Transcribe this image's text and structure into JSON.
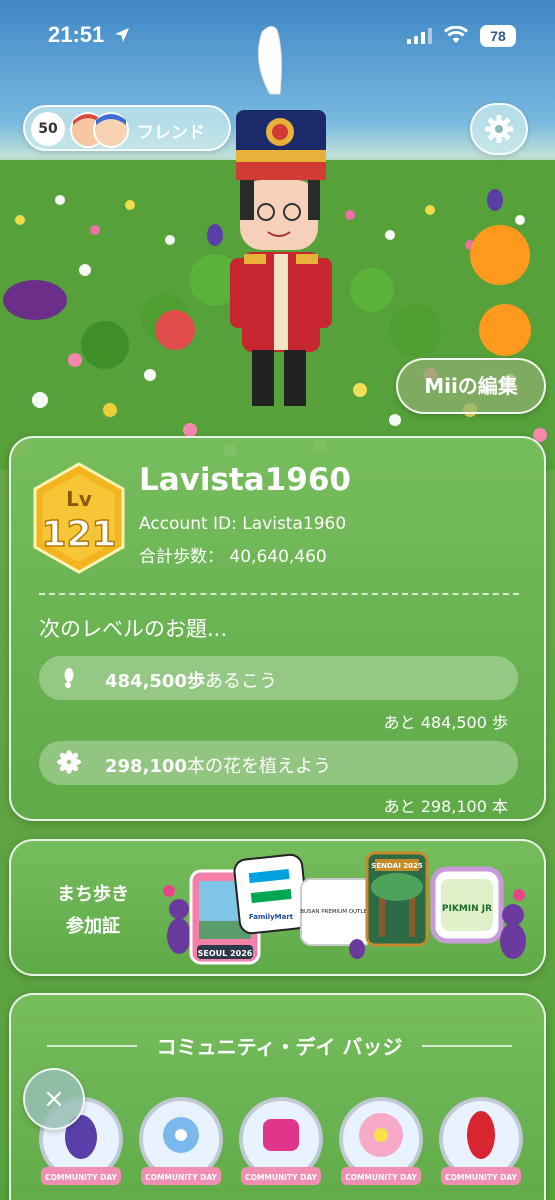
{
  "status_bar": {
    "time": "21:51",
    "battery": "78"
  },
  "friends": {
    "count": "50",
    "label": "フレンド"
  },
  "edit_mii_label": "Miiの編集",
  "profile": {
    "level_prefix": "Lv",
    "level": "121",
    "username": "Lavista1960",
    "account_id": "Account ID: Lavista1960",
    "total_steps": "合計歩数：  40,640,460"
  },
  "next_level": {
    "title": "次のレベルのお題...",
    "tasks": [
      {
        "icon": "footprint-icon",
        "value": "484,500歩",
        "suffix": "あるこう",
        "remaining": "あと 484,500 歩"
      },
      {
        "icon": "flower-icon",
        "value": "298,100",
        "suffix": "本の花を植えよう",
        "remaining": "あと 298,100 本"
      }
    ]
  },
  "town_pass": {
    "label_line1": "まち歩き",
    "label_line2": "参加証",
    "badges": [
      "SEOUL 2026",
      "FamilyMart",
      "BUSAN PREMIUM OUTLETS",
      "SENDAI 2025",
      "PIKMIN JR"
    ]
  },
  "community_day": {
    "title": "コミュニティ・デイ バッジ",
    "badge_label": "COMMUNITY DAY",
    "badge_count": 5
  },
  "close_label": "×",
  "colors": {
    "accent_gold": "#e8a51c",
    "card_green": "#6fb858"
  }
}
